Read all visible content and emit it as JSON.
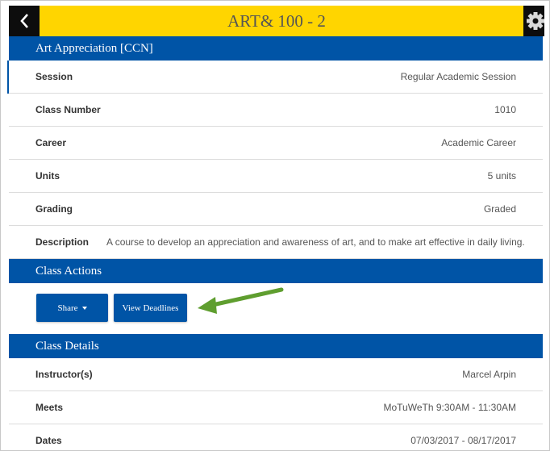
{
  "header": {
    "title": "ART& 100 - 2",
    "back_icon": "chevron-left-icon",
    "settings_icon": "gear-icon",
    "bar_color": "#ffd500"
  },
  "sections": {
    "course": {
      "title": "Art Appreciation [CCN]",
      "rows": [
        {
          "label": "Session",
          "value": "Regular Academic Session"
        },
        {
          "label": "Class Number",
          "value": "1010"
        },
        {
          "label": "Career",
          "value": "Academic Career"
        },
        {
          "label": "Units",
          "value": "5 units"
        },
        {
          "label": "Grading",
          "value": "Graded"
        },
        {
          "label": "Description",
          "value": "A course to develop an appreciation and awareness of art, and to make art effective in daily living."
        }
      ]
    },
    "actions": {
      "title": "Class Actions",
      "share_label": "Share",
      "deadlines_label": "View Deadlines"
    },
    "details": {
      "title": "Class Details",
      "rows": [
        {
          "label": "Instructor(s)",
          "value": "Marcel Arpin"
        },
        {
          "label": "Meets",
          "value": "MoTuWeTh 9:30AM - 11:30AM"
        },
        {
          "label": "Dates",
          "value": "07/03/2017 - 08/17/2017"
        }
      ]
    }
  },
  "colors": {
    "section_header": "#0054a6",
    "annotation_arrow": "#5f9e2f"
  }
}
